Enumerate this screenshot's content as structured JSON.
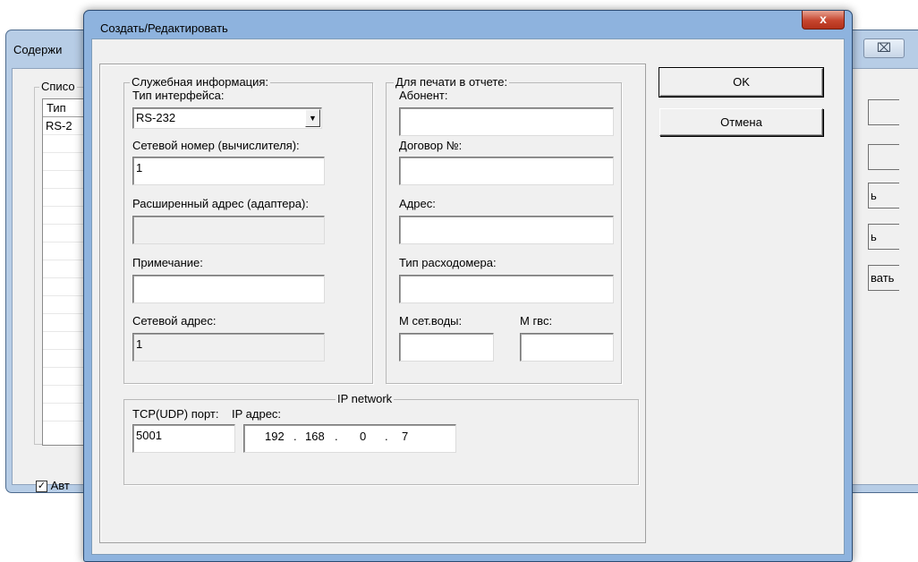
{
  "background_window": {
    "title": "Содержи",
    "close_glyph": "⌧",
    "group_label": "Списо",
    "list_header": "Тип",
    "list_rows": [
      "RS-2"
    ],
    "checkbox_label": "Авт",
    "checkbox_checked": true,
    "side_buttons": [
      "",
      "",
      "ь",
      "ь",
      "вать"
    ]
  },
  "dialog": {
    "title": "Создать/Редактировать",
    "close_glyph": "x",
    "service_group": {
      "legend": "Служебная информация:",
      "interface_type_label": "Тип интерфейса:",
      "interface_type_value": "RS-232",
      "network_number_label": "Сетевой номер (вычислителя):",
      "network_number_value": "1",
      "extended_address_label": "Расширенный адрес (адаптера):",
      "extended_address_value": "",
      "note_label": "Примечание:",
      "note_value": "",
      "network_address_label": "Сетевой адрес:",
      "network_address_value": "1"
    },
    "print_group": {
      "legend": "Для печати в отчете:",
      "subscriber_label": "Абонент:",
      "subscriber_value": "",
      "contract_label": "Договор №:",
      "contract_value": "",
      "address_label": "Адрес:",
      "address_value": "",
      "flowmeter_type_label": "Тип расходомера:",
      "flowmeter_type_value": "",
      "m_network_water_label": "М сет.воды:",
      "m_network_water_value": "",
      "m_hot_water_label": "М гвс:",
      "m_hot_water_value": ""
    },
    "ip_group": {
      "legend": "IP network",
      "port_label": "TCP(UDP) порт:",
      "port_value": "5001",
      "ip_label": "IP адрес:",
      "ip_octets": [
        "192",
        "168",
        "0",
        "7"
      ],
      "ip_dot": "."
    },
    "ok_label": "OK",
    "cancel_label": "Отмена"
  }
}
